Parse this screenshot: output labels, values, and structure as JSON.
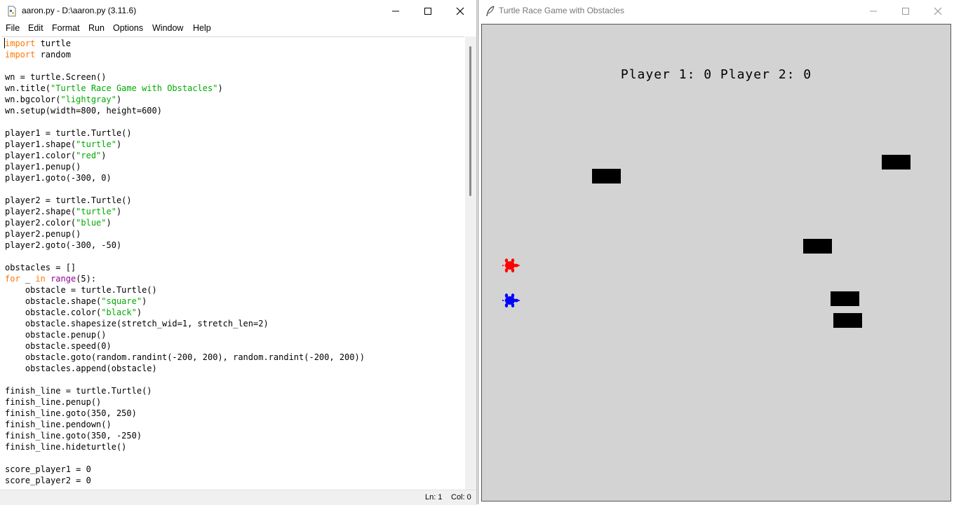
{
  "idle": {
    "title": "aaron.py - D:\\aaron.py (3.11.6)",
    "menu": [
      "File",
      "Edit",
      "Format",
      "Run",
      "Options",
      "Window",
      "Help"
    ],
    "status": {
      "line": "Ln: 1",
      "col": "Col: 0"
    }
  },
  "code_lines": [
    [
      [
        "kw",
        "import"
      ],
      [
        "t",
        " turtle"
      ]
    ],
    [
      [
        "kw",
        "import"
      ],
      [
        "t",
        " random"
      ]
    ],
    [],
    [
      [
        "t",
        "wn = turtle.Screen()"
      ]
    ],
    [
      [
        "t",
        "wn.title("
      ],
      [
        "str",
        "\"Turtle Race Game with Obstacles\""
      ],
      [
        "t",
        ")"
      ]
    ],
    [
      [
        "t",
        "wn.bgcolor("
      ],
      [
        "str",
        "\"lightgray\""
      ],
      [
        "t",
        ")"
      ]
    ],
    [
      [
        "t",
        "wn.setup(width=800, height=600)"
      ]
    ],
    [],
    [
      [
        "t",
        "player1 = turtle.Turtle()"
      ]
    ],
    [
      [
        "t",
        "player1.shape("
      ],
      [
        "str",
        "\"turtle\""
      ],
      [
        "t",
        ")"
      ]
    ],
    [
      [
        "t",
        "player1.color("
      ],
      [
        "str",
        "\"red\""
      ],
      [
        "t",
        ")"
      ]
    ],
    [
      [
        "t",
        "player1.penup()"
      ]
    ],
    [
      [
        "t",
        "player1.goto(-300, 0)"
      ]
    ],
    [],
    [
      [
        "t",
        "player2 = turtle.Turtle()"
      ]
    ],
    [
      [
        "t",
        "player2.shape("
      ],
      [
        "str",
        "\"turtle\""
      ],
      [
        "t",
        ")"
      ]
    ],
    [
      [
        "t",
        "player2.color("
      ],
      [
        "str",
        "\"blue\""
      ],
      [
        "t",
        ")"
      ]
    ],
    [
      [
        "t",
        "player2.penup()"
      ]
    ],
    [
      [
        "t",
        "player2.goto(-300, -50)"
      ]
    ],
    [],
    [
      [
        "t",
        "obstacles = []"
      ]
    ],
    [
      [
        "kw",
        "for"
      ],
      [
        "t",
        " _ "
      ],
      [
        "kw",
        "in"
      ],
      [
        "t",
        " "
      ],
      [
        "bi",
        "range"
      ],
      [
        "t",
        "(5):"
      ]
    ],
    [
      [
        "t",
        "    obstacle = turtle.Turtle()"
      ]
    ],
    [
      [
        "t",
        "    obstacle.shape("
      ],
      [
        "str",
        "\"square\""
      ],
      [
        "t",
        ")"
      ]
    ],
    [
      [
        "t",
        "    obstacle.color("
      ],
      [
        "str",
        "\"black\""
      ],
      [
        "t",
        ")"
      ]
    ],
    [
      [
        "t",
        "    obstacle.shapesize(stretch_wid=1, stretch_len=2)"
      ]
    ],
    [
      [
        "t",
        "    obstacle.penup()"
      ]
    ],
    [
      [
        "t",
        "    obstacle.speed(0)"
      ]
    ],
    [
      [
        "t",
        "    obstacle.goto(random.randint(-200, 200), random.randint(-200, 200))"
      ]
    ],
    [
      [
        "t",
        "    obstacles.append(obstacle)"
      ]
    ],
    [],
    [
      [
        "t",
        "finish_line = turtle.Turtle()"
      ]
    ],
    [
      [
        "t",
        "finish_line.penup()"
      ]
    ],
    [
      [
        "t",
        "finish_line.goto(350, 250)"
      ]
    ],
    [
      [
        "t",
        "finish_line.pendown()"
      ]
    ],
    [
      [
        "t",
        "finish_line.goto(350, -250)"
      ]
    ],
    [
      [
        "t",
        "finish_line.hideturtle()"
      ]
    ],
    [],
    [
      [
        "t",
        "score_player1 = 0"
      ]
    ],
    [
      [
        "t",
        "score_player2 = 0"
      ]
    ]
  ],
  "turtle_window": {
    "title": "Turtle Race Game with Obstacles",
    "score_text": "Player 1: 0  Player 2: 0",
    "background_color": "#d3d3d3",
    "obstacle_color": "#000000",
    "player1_color": "#ff0000",
    "player2_color": "#0000ff"
  }
}
